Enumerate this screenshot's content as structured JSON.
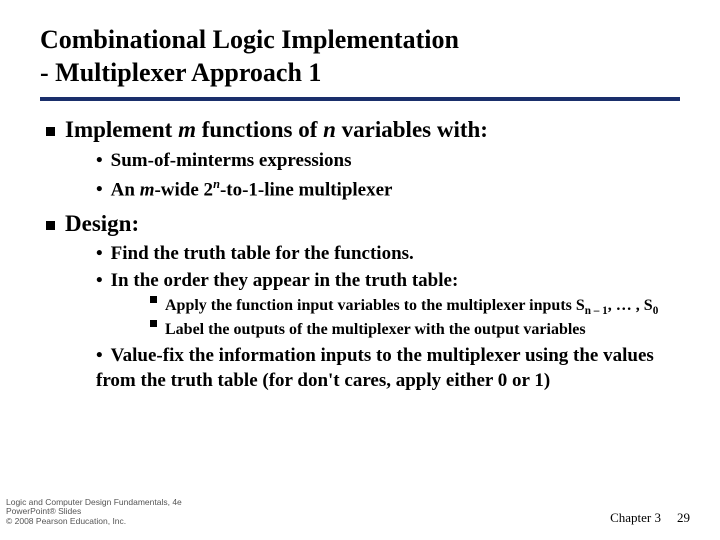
{
  "title_line1": "Combinational Logic Implementation",
  "title_line2": "- Multiplexer Approach 1",
  "bullets": {
    "b1_pre": "Implement ",
    "b1_m": "m",
    "b1_mid": " functions of ",
    "b1_n": "n",
    "b1_post": " variables with:",
    "b1a": "Sum-of-minterms expressions",
    "b1b_pre": "An ",
    "b1b_m": "m",
    "b1b_mid": "-wide 2",
    "b1b_n": "n",
    "b1b_post": "-to-1-line multiplexer",
    "b2": "Design:",
    "b2a": "Find the truth table for the functions.",
    "b2b": "In the order they appear in the truth table:",
    "b2b1_pre": "Apply the function input variables to the multiplexer inputs S",
    "b2b1_sub1": "n – 1",
    "b2b1_mid": ", … , S",
    "b2b1_sub2": "0",
    "b2b2": "Label the outputs of the multiplexer with the output variables",
    "b2c": "Value-fix the information inputs to the multiplexer using the values from the truth table (for don't cares, apply either 0 or 1)"
  },
  "footer": {
    "l1": "Logic and Computer Design Fundamentals, 4e",
    "l2": "PowerPoint® Slides",
    "l3": "© 2008 Pearson Education, Inc.",
    "chapter": "Chapter 3",
    "page": "29"
  }
}
